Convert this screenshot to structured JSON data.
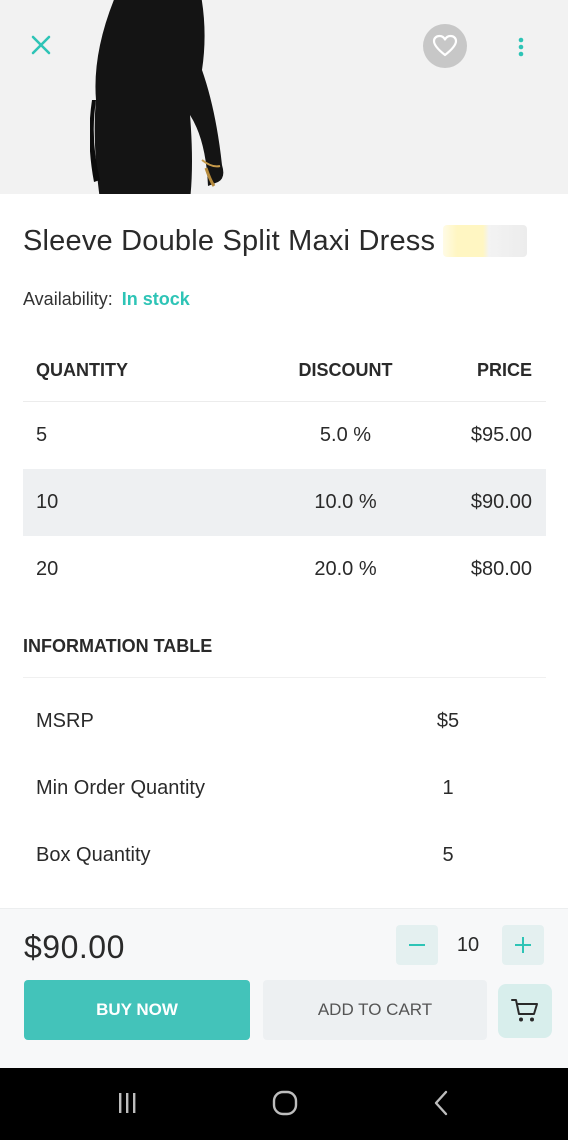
{
  "product": {
    "title": "Sleeve Double Split Maxi Dress",
    "availability_label": "Availability:",
    "availability_value": "In stock"
  },
  "discount_table": {
    "headers": {
      "quantity": "QUANTITY",
      "discount": "DISCOUNT",
      "price": "PRICE"
    },
    "rows": [
      {
        "quantity": "5",
        "discount": "5.0 %",
        "price": "$95.00"
      },
      {
        "quantity": "10",
        "discount": "10.0 %",
        "price": "$90.00"
      },
      {
        "quantity": "20",
        "discount": "20.0 %",
        "price": "$80.00"
      }
    ]
  },
  "info_table": {
    "heading": "INFORMATION TABLE",
    "rows": [
      {
        "label": "MSRP",
        "value": "$5"
      },
      {
        "label": "Min Order Quantity",
        "value": "1"
      },
      {
        "label": "Box Quantity",
        "value": "5"
      }
    ]
  },
  "bottom_bar": {
    "total_price": "$90.00",
    "quantity": "10",
    "minus": "−",
    "plus": "+",
    "buy_now": "BUY NOW",
    "add_to_cart": "ADD TO CART"
  },
  "icons": {
    "close": "close-icon",
    "favorite": "heart-icon",
    "more": "more-vertical-icon",
    "cart": "cart-icon",
    "nav_recent": "recent-apps-icon",
    "nav_home": "home-icon",
    "nav_back": "back-icon"
  },
  "colors": {
    "accent": "#43c3ba",
    "stock": "#2ec4b6",
    "stepper_bg": "#e4f0f0",
    "row_highlight": "#eef0f2"
  }
}
